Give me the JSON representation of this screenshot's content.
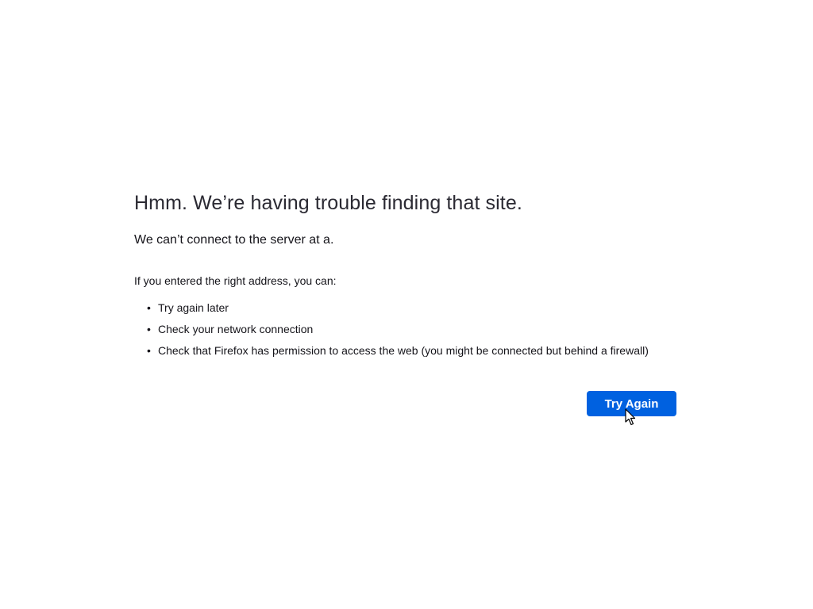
{
  "error": {
    "title": "Hmm. We’re having trouble finding that site.",
    "subtitle": "We can’t connect to the server at a.",
    "intro": "If you entered the right address, you can:",
    "suggestions": [
      "Try again later",
      "Check your network connection",
      "Check that Firefox has permission to access the web (you might be connected but behind a firewall)"
    ],
    "bullet": "•"
  },
  "actions": {
    "try_again_label": "Try Again"
  },
  "colors": {
    "primary_button": "#0061e0",
    "title_text": "#2b2a33",
    "body_text": "#15141a"
  },
  "icons": {
    "cursor": "mouse-pointer-icon"
  }
}
